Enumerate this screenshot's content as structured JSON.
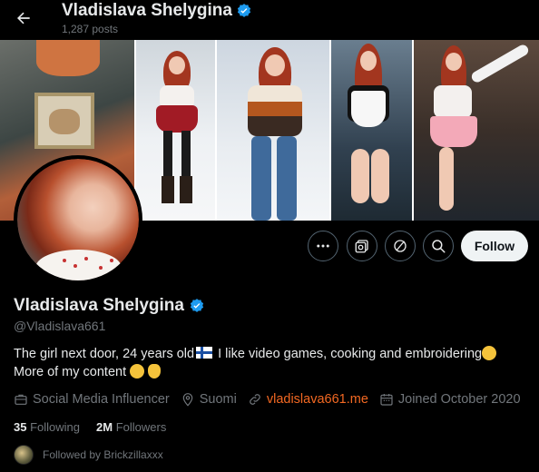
{
  "header": {
    "display_name": "Vladislava Shelygina",
    "posts_count": "1,287 posts"
  },
  "profile": {
    "display_name": "Vladislava Shelygina",
    "handle": "@Vladislava661",
    "bio": {
      "part1": "The girl next door, 24 years old",
      "part2": " I like video games, cooking and embroidering",
      "part3": " More of my content"
    },
    "category": "Social Media Influencer",
    "location": "Suomi",
    "website": "vladislava661.me",
    "joined": "Joined October 2020",
    "following_count": "35",
    "following_label": "Following",
    "followers_count": "2M",
    "followers_label": "Followers",
    "followed_by": "Followed by Brickzillaxxx"
  },
  "actions": {
    "follow_label": "Follow"
  },
  "colors": {
    "verified": "#1d9bf0",
    "link": "#f26822",
    "muted": "#71767b"
  },
  "icons": {
    "back": "arrow-left-icon",
    "more": "more-horizontal-icon",
    "subscribe": "subscribe-media-icon",
    "grok": "grok-icon",
    "search": "search-icon",
    "verified": "verified-badge-icon",
    "category": "briefcase-icon",
    "location": "location-pin-icon",
    "website": "link-icon",
    "joined": "calendar-icon"
  }
}
